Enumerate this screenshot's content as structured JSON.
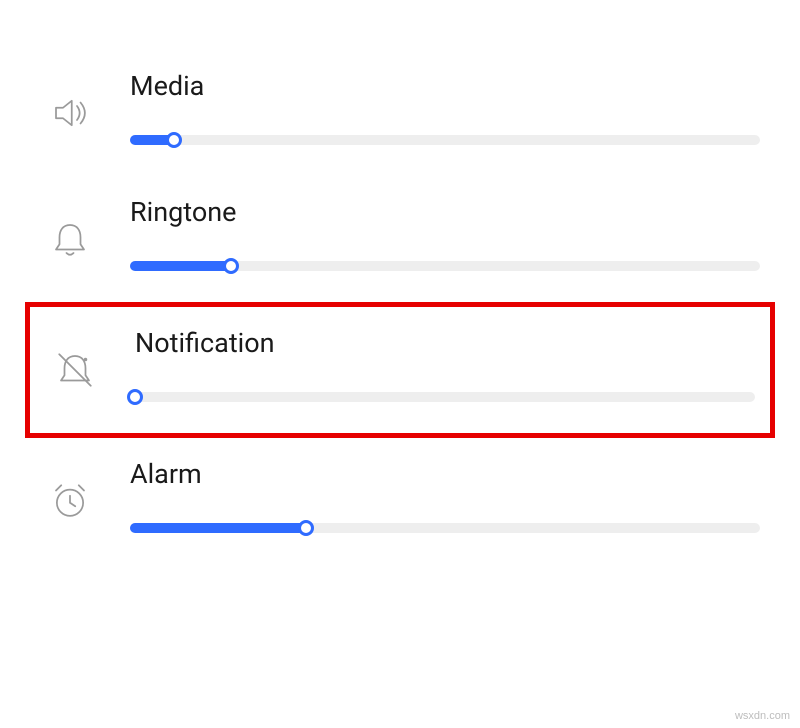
{
  "volumes": {
    "media": {
      "label": "Media",
      "value": 7,
      "max": 100,
      "icon": "speaker-icon"
    },
    "ringtone": {
      "label": "Ringtone",
      "value": 16,
      "max": 100,
      "icon": "bell-icon"
    },
    "notification": {
      "label": "Notification",
      "value": 0,
      "max": 100,
      "icon": "bell-muted-icon",
      "highlighted": true
    },
    "alarm": {
      "label": "Alarm",
      "value": 28,
      "max": 100,
      "icon": "alarm-clock-icon"
    }
  },
  "colors": {
    "accent": "#2f6bff",
    "highlight_border": "#e60000",
    "track": "#eeeeee",
    "icon": "#9a9a9a"
  },
  "watermark": "wsxdn.com"
}
